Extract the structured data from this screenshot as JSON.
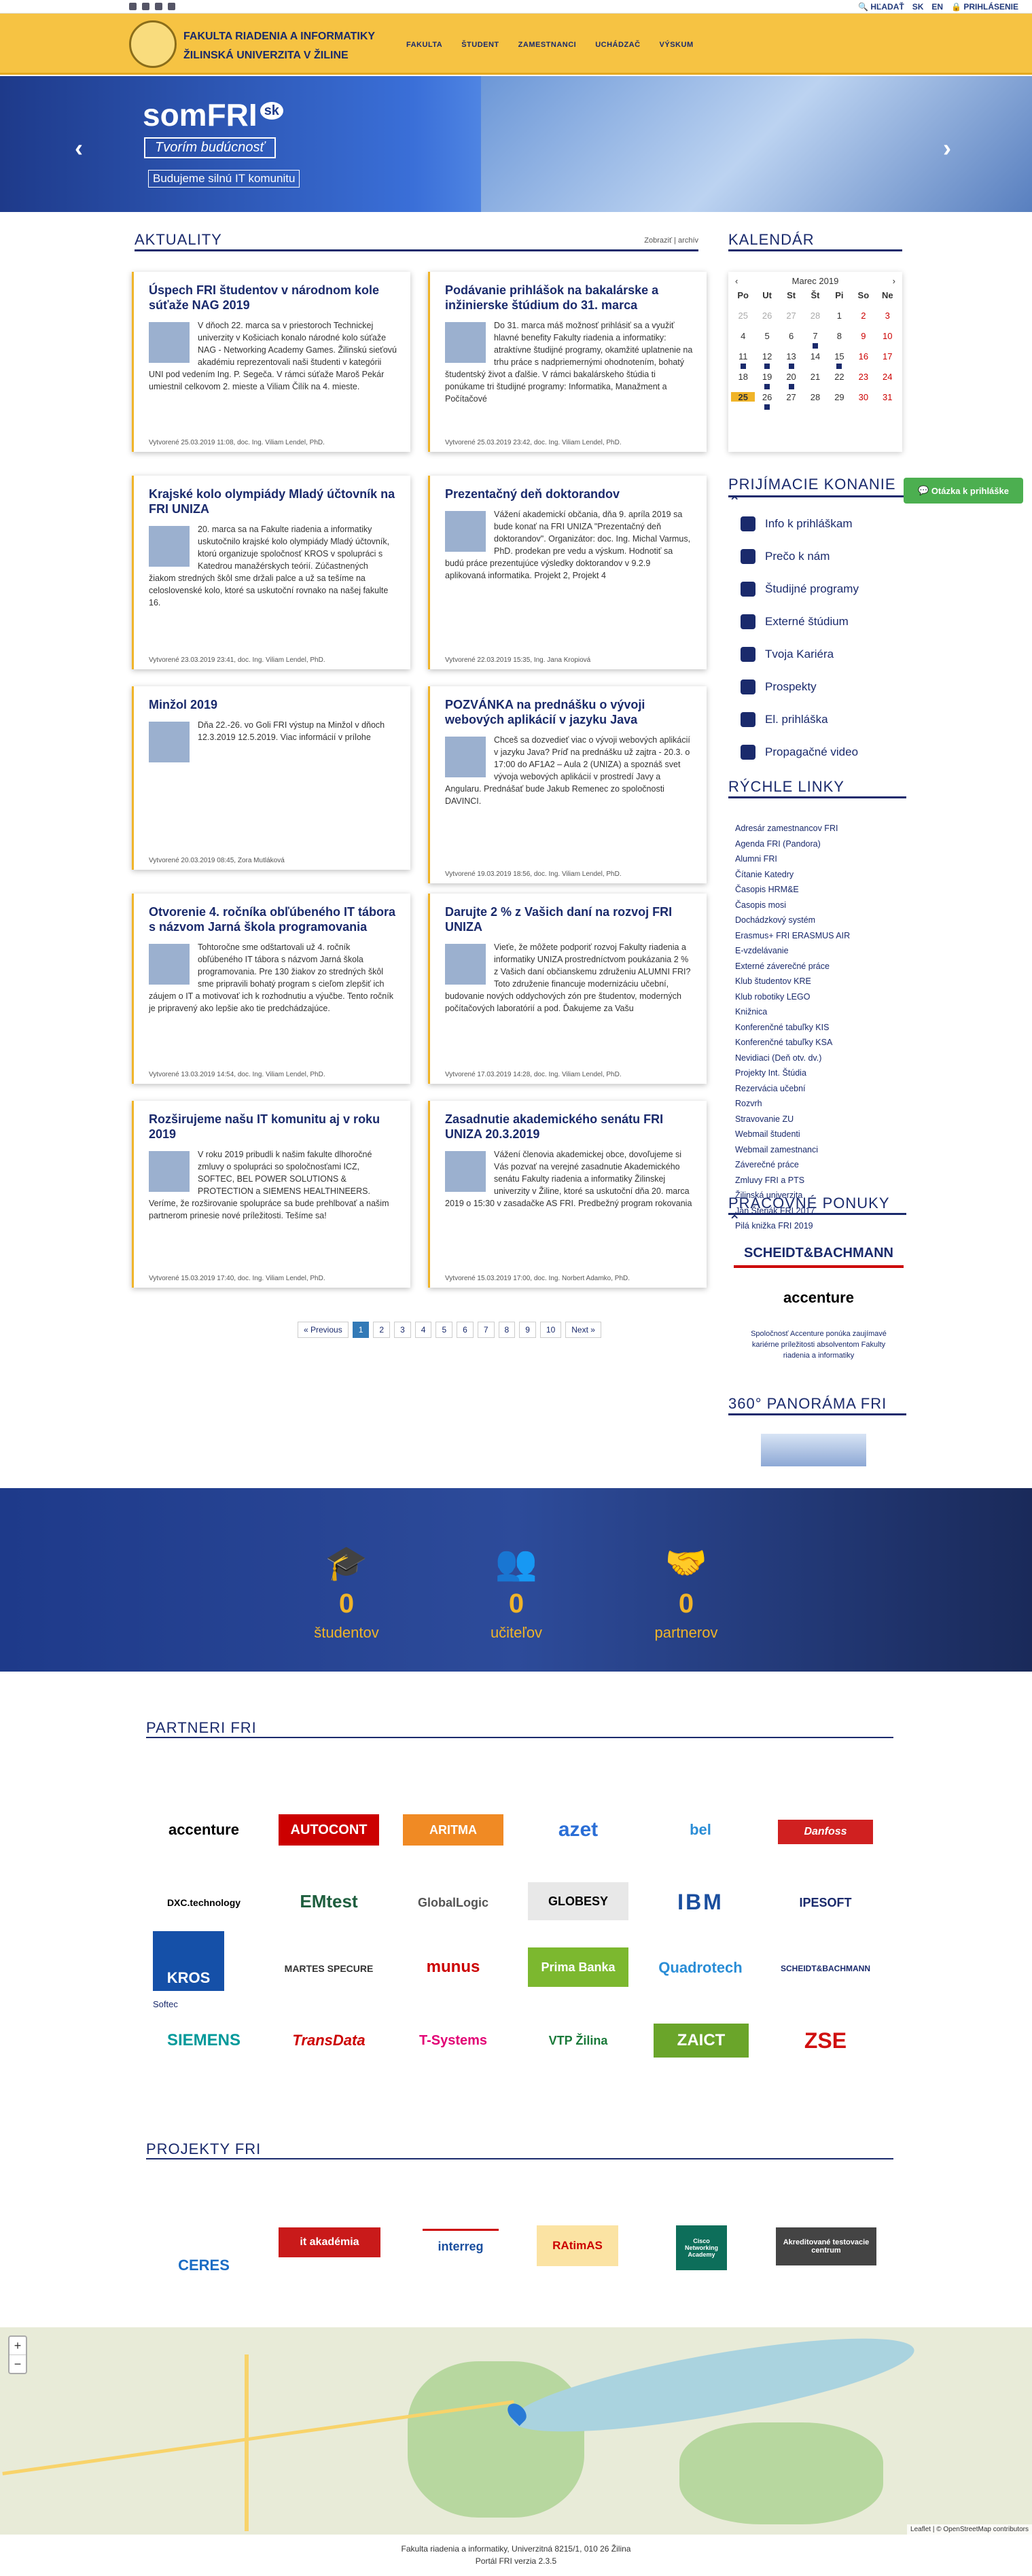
{
  "topbar": {
    "search": "HĽADAŤ",
    "lang": "SK",
    "lang_en": "EN",
    "login": "PRIHLÁSENIE"
  },
  "header": {
    "line1": "FAKULTA RIADENIA A INFORMATIKY",
    "line2": "ŽILINSKÁ UNIVERZITA V ŽILINE",
    "nav": [
      "Fakulta",
      "Študent",
      "Zamestnanci",
      "Uchádzač",
      "Výskum"
    ]
  },
  "slider": {
    "brand": "somFRI",
    "brand_badge": "sk",
    "tagline": "Tvorím budúcnosť",
    "subtitle": "Budujeme silnú IT komunitu"
  },
  "news": {
    "title": "Aktuality",
    "more": "Zobraziť | archív",
    "cards": [
      {
        "title": "Úspech FRI študentov v národnom kole súťaže NAG 2019",
        "body": "V dňoch 22. marca sa v priestoroch Technickej univerzity v Košiciach konalo národné kolo súťaže NAG - Networking Academy Games. Žilinskú sieťovú akadémiu reprezentovali naši študenti v kategórii UNI pod vedením Ing. P. Segeča. V rámci súťaže Maroš Pekár umiestnil celkovom 2. mieste a Viliam Čilík na 4. mieste.",
        "meta": "Vytvorené 25.03.2019 11:08, doc. Ing. Viliam Lendel, PhD."
      },
      {
        "title": "Podávanie prihlášok na bakalárske a inžinierske štúdium do 31. marca",
        "body": "Do 31. marca máš možnosť prihlásiť sa a využiť hlavné benefity Fakulty riadenia a informatiky: atraktívne študijné programy, okamžité uplatnenie na trhu práce s nadpriemernými ohodnotením, bohatý študentský život a ďalšie. V rámci bakalárskeho štúdia ti ponúkame tri študijné programy: Informatika, Manažment a Počítačové",
        "meta": "Vytvorené 25.03.2019 23:42, doc. Ing. Viliam Lendel, PhD."
      },
      {
        "title": "Krajské kolo olympiády Mladý účtovník na FRI UNIZA",
        "body": "20. marca sa na Fakulte riadenia a informatiky uskutočnilo krajské kolo olympiády Mladý účtovník, ktorú organizuje spoločnosť KROS v spolupráci s Katedrou manažérskych teórií. Zúčastnených žiakom stredných škôl sme držali palce a už sa tešíme na celoslovenské kolo, ktoré sa uskutoční rovnako na našej fakulte 16.",
        "meta": "Vytvorené 23.03.2019 23:41, doc. Ing. Viliam Lendel, PhD."
      },
      {
        "title": "Prezentačný deň doktorandov",
        "body": "Vážení akademickí občania, dňa 9. apríla 2019 sa bude konať na FRI UNIZA \"Prezentačný deň doktorandov\". Organizátor: doc. Ing. Michal Varmus, PhD. prodekan pre vedu a výskum. Hodnotiť sa budú práce prezentujúce výsledky doktorandov v 9.2.9 aplikovaná informatika. Projekt 2, Projekt 4",
        "meta": "Vytvorené 22.03.2019 15:35, Ing. Jana Kropiová"
      },
      {
        "title": "Minžol 2019",
        "body": "Dňa 22.-26. vo Goli FRI výstup na Minžol v dňoch 12.3.2019 12.5.2019. Viac informácií v prílohe",
        "meta": "Vytvorené 20.03.2019 08:45, Zora Mutláková"
      },
      {
        "title": "POZVÁNKA na prednášku o vývoji webových aplikácií v jazyku Java",
        "body": "Chceš sa dozvedieť viac o vývoji webových aplikácií v jazyku Java? Príď na prednášku už zajtra - 20.3. o 17:00 do AF1A2 – Aula 2 (UNIZA) a spoznáš svet vývoja webových aplikácií v prostredí Javy a Angularu. Prednášať bude Jakub Remenec zo spoločnosti DAVINCI.",
        "meta": "Vytvorené 19.03.2019 18:56, doc. Ing. Viliam Lendel, PhD."
      },
      {
        "title": "Otvorenie 4. ročníka obľúbeného IT tábora s názvom Jarná škola programovania",
        "body": "Tohtoročne sme odštartovali už 4. ročník obľúbeného IT tábora s názvom Jarná škola programovania. Pre 130 žiakov zo stredných škôl sme pripravili bohatý program s cieľom zlepšiť ich záujem o IT a motivovať ich k rozhodnutiu a výučbe. Tento ročník je pripravený ako lepšie ako tie predchádzajúce.",
        "meta": "Vytvorené 13.03.2019 14:54, doc. Ing. Viliam Lendel, PhD."
      },
      {
        "title": "Darujte 2 % z Vašich daní na rozvoj FRI UNIZA",
        "body": "Vieťe, že môžete podporiť rozvoj Fakulty riadenia a informatiky UNIZA prostredníctvom poukázania 2 % z Vašich daní občianskemu združeniu ALUMNI FRI? Toto združenie financuje modernizáciu učební, budovanie nových oddychových zón pre študentov, moderných počítačových laboratórií a pod. Ďakujeme za Vašu",
        "meta": "Vytvorené 17.03.2019 14:28, doc. Ing. Viliam Lendel, PhD."
      },
      {
        "title": "Rozširujeme našu IT komunitu aj v roku 2019",
        "body": "V roku 2019 pribudli k našim fakulte dlhoročné zmluvy o spolupráci so spoločnosťami ICZ, SOFTEC, BEL POWER SOLUTIONS & PROTECTION a SIEMENS HEALTHINEERS. Veríme, že rozširovanie spolupráce sa bude prehlbovať a našim partnerom prinesie nové príležitosti. Tešíme sa!",
        "meta": "Vytvorené 15.03.2019 17:40, doc. Ing. Viliam Lendel, PhD."
      },
      {
        "title": "Zasadnutie akademického senátu FRI UNIZA 20.3.2019",
        "body": "Vážení členovia akademickej obce, dovoľujeme si Vás pozvať na verejné zasadnutie Akademického senátu Fakulty riadenia a informatiky Žilinskej univerzity v Žiline, ktoré sa uskutoční dňa 20. marca 2019 o 15:30 v zasadačke AS FRI. Predbežný program rokovania",
        "meta": "Vytvorené 15.03.2019 17:00, doc. Ing. Norbert Adamko, PhD."
      }
    ],
    "pagination": [
      "« Previous",
      "1",
      "2",
      "3",
      "4",
      "5",
      "6",
      "7",
      "8",
      "9",
      "10",
      "Next »"
    ]
  },
  "calendar": {
    "title": "Kalendár",
    "month": "Marec 2019",
    "dow": [
      "Po",
      "Ut",
      "St",
      "Št",
      "Pi",
      "So",
      "Ne"
    ],
    "days": [
      "25",
      "26",
      "27",
      "28",
      "1",
      "2",
      "3",
      "4",
      "5",
      "6",
      "7",
      "8",
      "9",
      "10",
      "11",
      "12",
      "13",
      "14",
      "15",
      "16",
      "17",
      "18",
      "19",
      "20",
      "21",
      "22",
      "23",
      "24",
      "25",
      "26",
      "27",
      "28",
      "29",
      "30",
      "31"
    ]
  },
  "admissions": {
    "title": "Prijímacie konanie",
    "help": "Otázka k prihláške",
    "items": [
      "Info k prihláškam",
      "Prečo k nám",
      "Študijné programy",
      "Externé štúdium",
      "Tvoja Kariéra",
      "Prospekty",
      "El. prihláška",
      "Propagačné video"
    ]
  },
  "quick": {
    "title": "Rýchle linky",
    "links": [
      "Adresár zamestnancov FRI",
      "Agenda FRI (Pandora)",
      "Alumni FRI",
      "Čítanie Katedry",
      "Časopis HRM&E",
      "Časopis mosi",
      "Dochádzkový systém",
      "Erasmus+ FRI ERASMUS AIR",
      "E-vzdelávanie",
      "Externé záverečné práce",
      "Klub študentov KRE",
      "Klub robotiky LEGO",
      "Knižnica",
      "Konferenčné tabuľky KIS",
      "Konferenčné tabuľky KSA",
      "Nevidiaci (Deň otv. dv.)",
      "Projekty Int. Štúdia",
      "Rezervácia učební",
      "Rozvrh",
      "Stravovanie ZU",
      "Webmail študenti",
      "Webmail zamestnanci",
      "Záverečné práce",
      "Zmluvy FRI a PTS",
      "Žilinská univerzita",
      "Ján Šteriák FRI 2017",
      "Pilá knižka FRI 2019"
    ]
  },
  "work": {
    "title": "Pracovné ponuky",
    "accent_note": "Spoločnosť Accenture ponúka zaujímavé kariérne príležitosti absolventom Fakulty riadenia a informatiky"
  },
  "panorama": {
    "title": "360° panoráma FRI"
  },
  "stats": {
    "items": [
      {
        "value": "0",
        "label": "študentov"
      },
      {
        "value": "0",
        "label": "učiteľov"
      },
      {
        "value": "0",
        "label": "partnerov"
      }
    ]
  },
  "partners": {
    "title": "Partneri FRI",
    "logos": [
      "accenture",
      "AUTOCONT",
      "ARITMA",
      "azet",
      "bel",
      "Danfoss",
      "DXC.technology",
      "EMtest",
      "GlobalLogic",
      "GLOBESY",
      "IBM",
      "IPESOFT",
      "KROS",
      "MARTES SPECURE",
      "munus",
      "Prima Banka",
      "Quadrotech",
      "SCHEIDT&BACHMANN",
      "SIEMENS",
      "TransData",
      "T-Systems",
      "VTP Žilina",
      "ZAICT",
      "ZSE"
    ],
    "softec": "Softec"
  },
  "projects": {
    "title": "Projekty FRI",
    "logos": [
      "CERES",
      "it akadémia",
      "interreg",
      "RAtimAS",
      "Cisco Networking Academy",
      "Akreditované testovacie centrum"
    ]
  },
  "map": {
    "attribution": "Leaflet | © OpenStreetMap contributors",
    "zoom_in": "+",
    "zoom_out": "−"
  },
  "footer": {
    "address": "Fakulta riadenia a informatiky, Univerzitná 8215/1, 010 26 Žilina",
    "portal": "Portál FRI verzia 2.3.5"
  }
}
